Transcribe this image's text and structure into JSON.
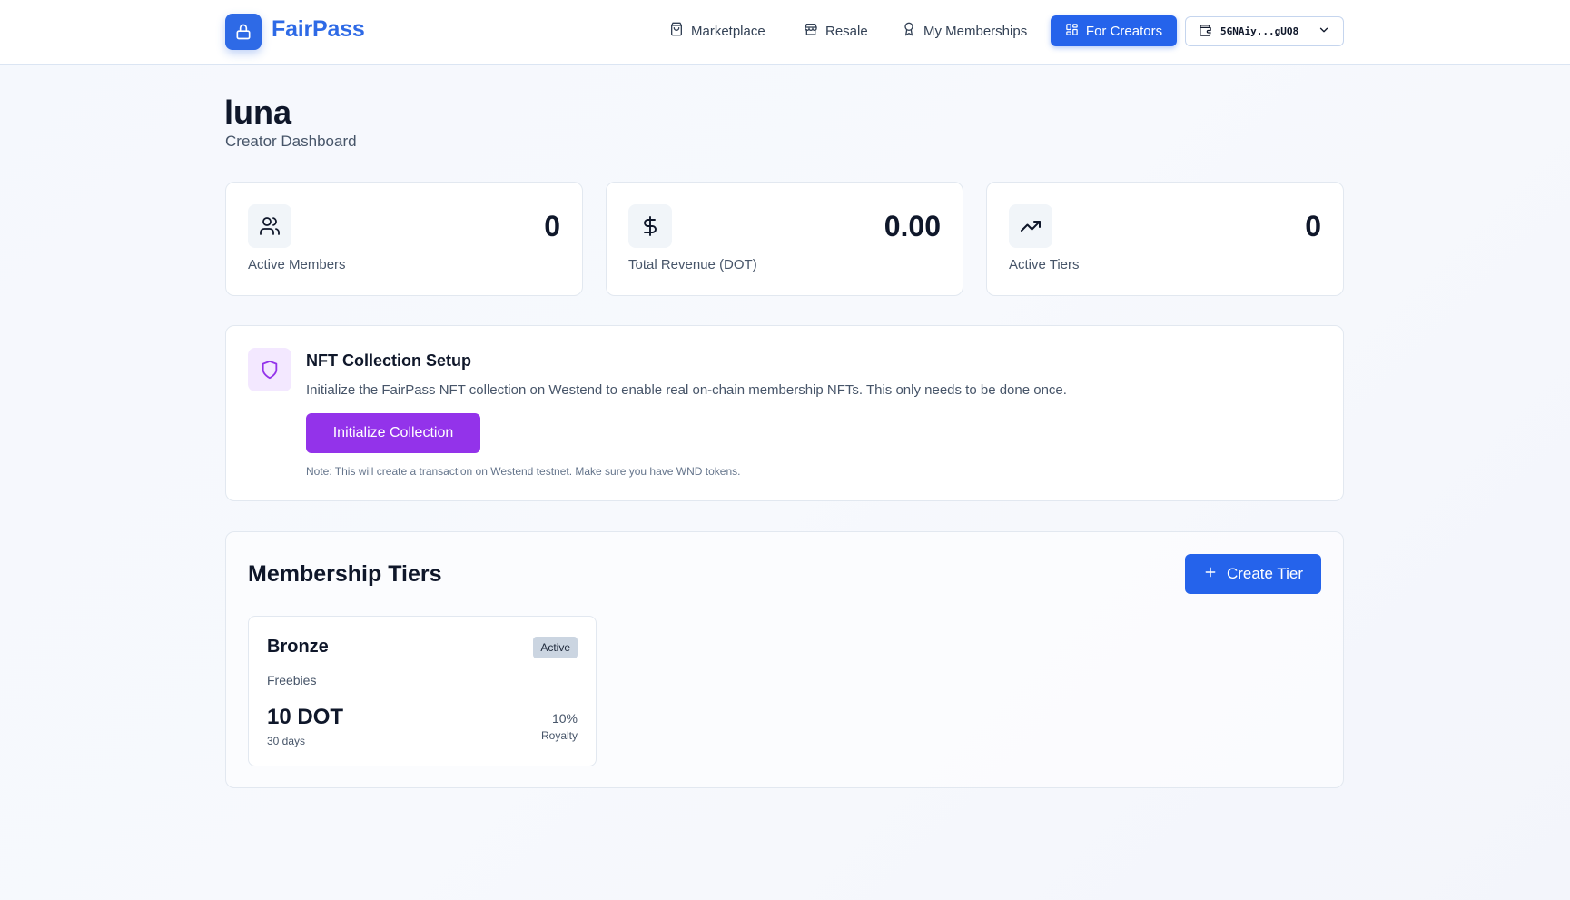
{
  "header": {
    "brand": "FairPass",
    "nav": [
      {
        "label": "Marketplace",
        "icon": "shopping-bag-icon"
      },
      {
        "label": "Resale",
        "icon": "store-icon"
      },
      {
        "label": "My Memberships",
        "icon": "award-icon"
      }
    ],
    "for_creators": {
      "label": "For Creators",
      "icon": "grid-icon"
    },
    "wallet": {
      "address": "5GNAiy...gUQ8",
      "icon": "wallet-icon"
    }
  },
  "page": {
    "title": "luna",
    "subtitle": "Creator Dashboard"
  },
  "stats": [
    {
      "label": "Active Members",
      "value": "0",
      "icon": "users-icon"
    },
    {
      "label": "Total Revenue (DOT)",
      "value": "0.00",
      "icon": "dollar-icon"
    },
    {
      "label": "Active Tiers",
      "value": "0",
      "icon": "trending-up-icon"
    }
  ],
  "nft_setup": {
    "title": "NFT Collection Setup",
    "description": "Initialize the FairPass NFT collection on Westend to enable real on-chain membership NFTs. This only needs to be done once.",
    "button_label": "Initialize Collection",
    "note": "Note: This will create a transaction on Westend testnet. Make sure you have WND tokens."
  },
  "tiers": {
    "title": "Membership Tiers",
    "create_label": "Create Tier",
    "items": [
      {
        "name": "Bronze",
        "status": "Active",
        "description": "Freebies",
        "price": "10 DOT",
        "duration": "30 days",
        "royalty": "10%",
        "royalty_label": "Royalty"
      }
    ]
  },
  "colors": {
    "primary": "#2563eb",
    "brand": "#2e6ae6",
    "purple": "#9333ea"
  }
}
